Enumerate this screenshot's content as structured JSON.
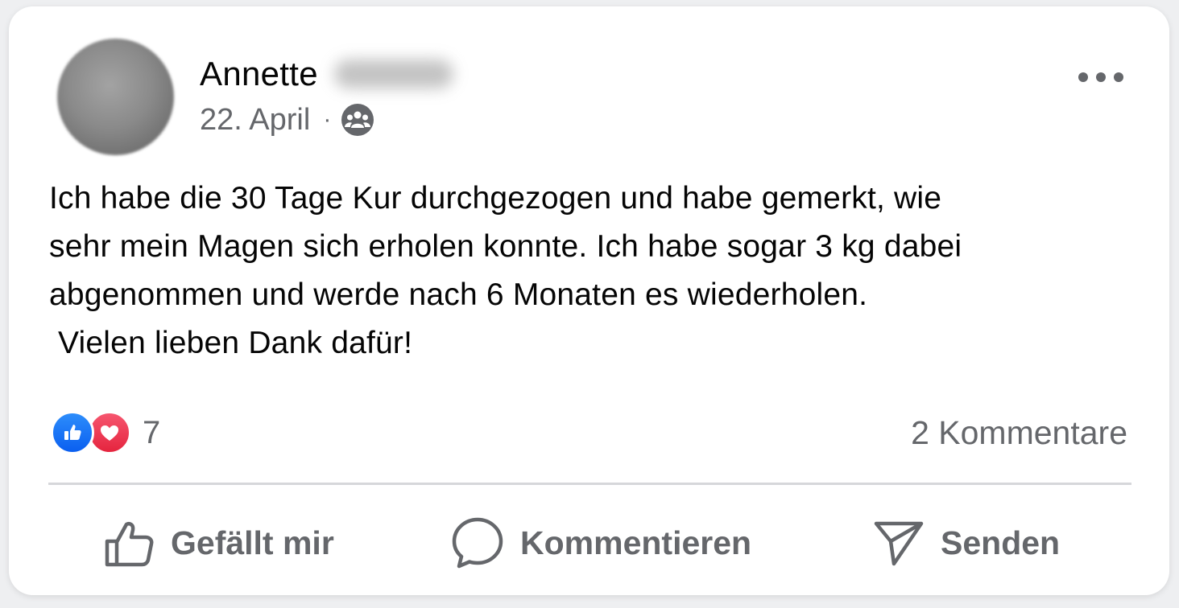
{
  "post": {
    "author_first_name": "Annette",
    "date": "22. April",
    "separator": "·",
    "audience_icon": "group-icon",
    "text": "Ich habe die 30 Tage Kur durchgezogen und habe gemerkt, wie\nsehr mein Magen sich erholen konnte. Ich habe sogar 3 kg dabei\nabgenommen und werde nach 6 Monaten es wiederholen.\n Vielen lieben Dank dafür!"
  },
  "reactions": {
    "icons": [
      "like-icon",
      "love-icon"
    ],
    "count": "7",
    "like_color": "#1877f2",
    "love_color": "#f33e58"
  },
  "comments": {
    "label": "2 Kommentare"
  },
  "actions": {
    "like_label": "Gefällt mir",
    "comment_label": "Kommentieren",
    "send_label": "Senden"
  },
  "colors": {
    "text_primary": "#050505",
    "text_secondary": "#65676b",
    "divider": "#d6d7da"
  }
}
